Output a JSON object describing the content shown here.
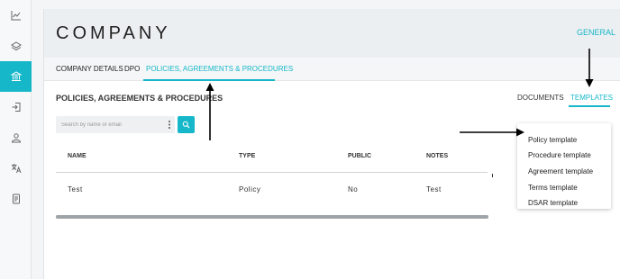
{
  "sidebar": {
    "items": [
      {
        "icon": "chart-line-icon",
        "active": false
      },
      {
        "icon": "layers-icon",
        "active": false
      },
      {
        "icon": "bank-icon",
        "active": true
      },
      {
        "icon": "login-icon",
        "active": false
      },
      {
        "icon": "user-icon",
        "active": false
      },
      {
        "icon": "translate-icon",
        "active": false
      },
      {
        "icon": "document-icon",
        "active": false
      }
    ]
  },
  "header": {
    "title": "COMPANY",
    "general_link": "GENERAL"
  },
  "subnav": {
    "items": [
      {
        "label": "COMPANY DETAILS"
      },
      {
        "label": "DPO"
      },
      {
        "label": "POLICIES, AGREEMENTS & PROCEDURES"
      }
    ]
  },
  "section": {
    "title": "POLICIES, AGREEMENTS & PROCEDURES",
    "tabs": [
      {
        "label": "DOCUMENTS"
      },
      {
        "label": "TEMPLATES"
      }
    ]
  },
  "search": {
    "placeholder": "Search by name or email"
  },
  "table": {
    "headers": [
      "NAME",
      "TYPE",
      "PUBLIC",
      "NOTES"
    ],
    "rows": [
      [
        "Test",
        "Policy",
        "No",
        "Test"
      ]
    ]
  },
  "dropdown": {
    "items": [
      {
        "label": "Policy template"
      },
      {
        "label": "Procedure template"
      },
      {
        "label": "Agreement template"
      },
      {
        "label": "Terms template"
      },
      {
        "label": "DSAR template"
      }
    ]
  },
  "colors": {
    "accent": "#16b7c9",
    "header_bg": "#eceff1",
    "annotation_arrow": "#000000"
  }
}
